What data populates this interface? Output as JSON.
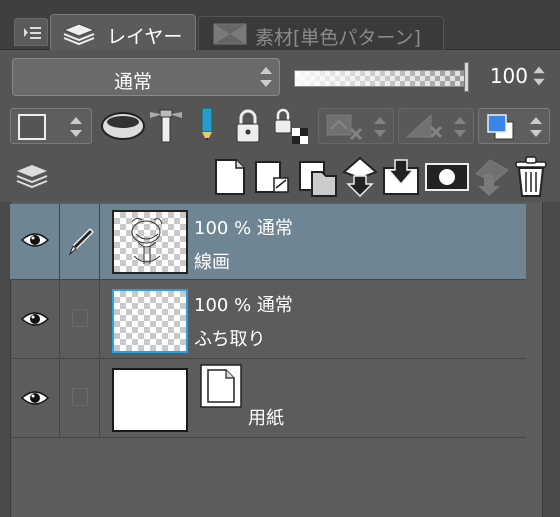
{
  "tabs": [
    {
      "label": "レイヤー",
      "icon": "layers-icon",
      "active": true
    },
    {
      "label": "素材[単色パターン]",
      "icon": "material-icon",
      "active": false
    }
  ],
  "blend_mode": {
    "value": "通常"
  },
  "opacity": {
    "value": "100",
    "level": 1.0
  },
  "layers": [
    {
      "opacity": "100 %",
      "blend": "通常",
      "name": "線画",
      "visible": true,
      "thumb": "sketch",
      "selected": true,
      "drawing_target": true
    },
    {
      "opacity": "100 %",
      "blend": "通常",
      "name": "ふち取り",
      "visible": true,
      "thumb": "transparent",
      "selected": false
    },
    {
      "opacity": "",
      "blend": "",
      "name": "用紙",
      "visible": true,
      "thumb": "paper",
      "selected": false
    }
  ],
  "colors": {
    "panel": "#555555",
    "selected_row": "#6f8593",
    "accent_blue": "#3a86e8"
  }
}
